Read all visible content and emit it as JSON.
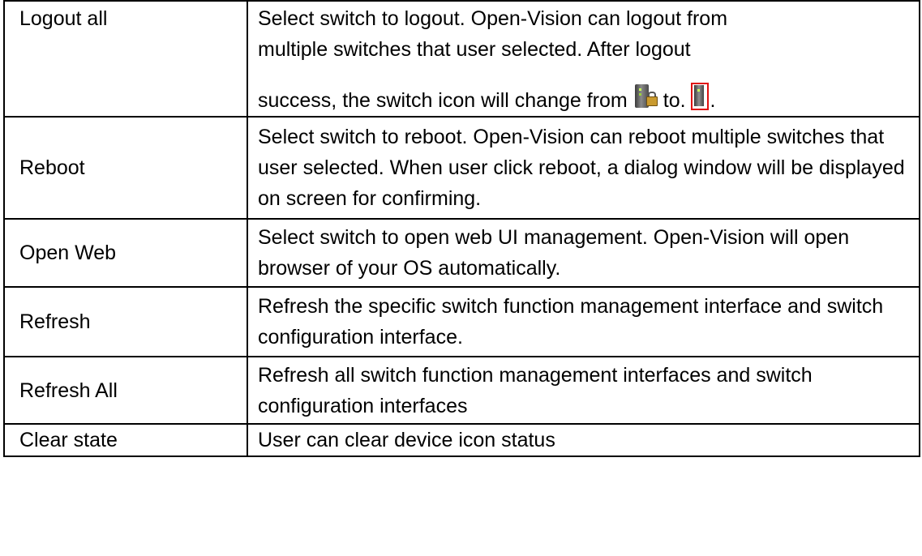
{
  "rows": [
    {
      "function": "Logout all",
      "desc_lines": [
        "Select switch to logout. Open-Vision can logout from",
        "multiple switches that user selected. After logout"
      ],
      "desc_tail_before": "success, the switch icon will change from",
      "desc_tail_mid": "to.",
      "desc_tail_end": ".",
      "icons": [
        "switch-locked-icon",
        "switch-logged-out-icon"
      ]
    },
    {
      "function": "Reboot",
      "description": "Select switch to reboot. Open-Vision can reboot multiple switches that user selected. When user click reboot, a dialog window will be displayed on screen for confirming."
    },
    {
      "function": "Open Web",
      "description": "Select switch to open web UI management. Open-Vision will open browser of your OS automatically."
    },
    {
      "function": "Refresh",
      "description": "Refresh the specific switch function management interface and switch configuration interface."
    },
    {
      "function": "Refresh All",
      "description": "Refresh all switch function management interfaces and switch configuration interfaces"
    },
    {
      "function": "Clear state",
      "description": "User can clear device icon status"
    }
  ],
  "colors": {
    "border": "#000000",
    "icon_red_frame": "#e01010"
  }
}
